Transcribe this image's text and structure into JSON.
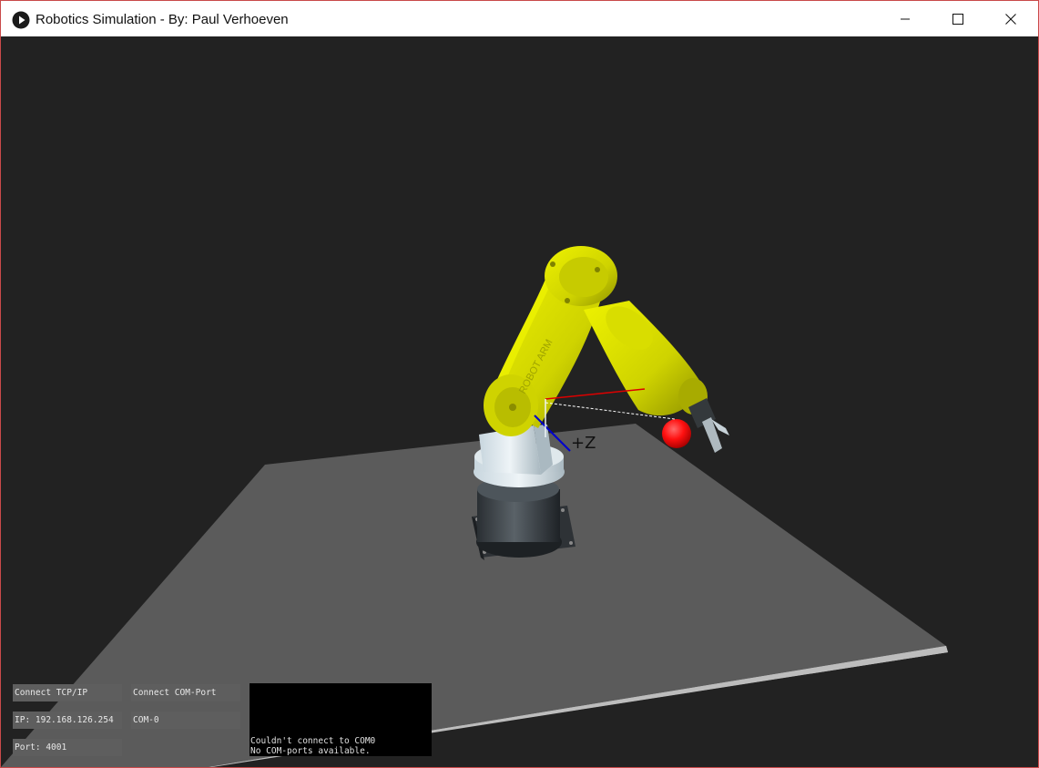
{
  "window": {
    "title": "Robotics Simulation - By: Paul Verhoeven",
    "app_icon": "play-circle-icon",
    "controls": [
      "minimize-icon",
      "maximize-icon",
      "close-icon"
    ]
  },
  "scene": {
    "axis_label": "+Z",
    "robot_label": "ROBOT ARM",
    "colors": {
      "background": "#222222",
      "floor": "#5a5a5a",
      "robot_arm": "#d8dc00",
      "target_sphere": "#ff1a1a",
      "x_axis": "#dd0000",
      "z_axis": "#0000cc"
    }
  },
  "controls": {
    "connect_tcp": "Connect TCP/IP",
    "connect_com": "Connect COM-Port",
    "ip": "IP: 192.168.126.254",
    "com_port": "COM-0",
    "port": "Port: 4001"
  },
  "console": {
    "lines": [
      "Couldn't connect to COM0",
      "No COM-ports available."
    ]
  }
}
